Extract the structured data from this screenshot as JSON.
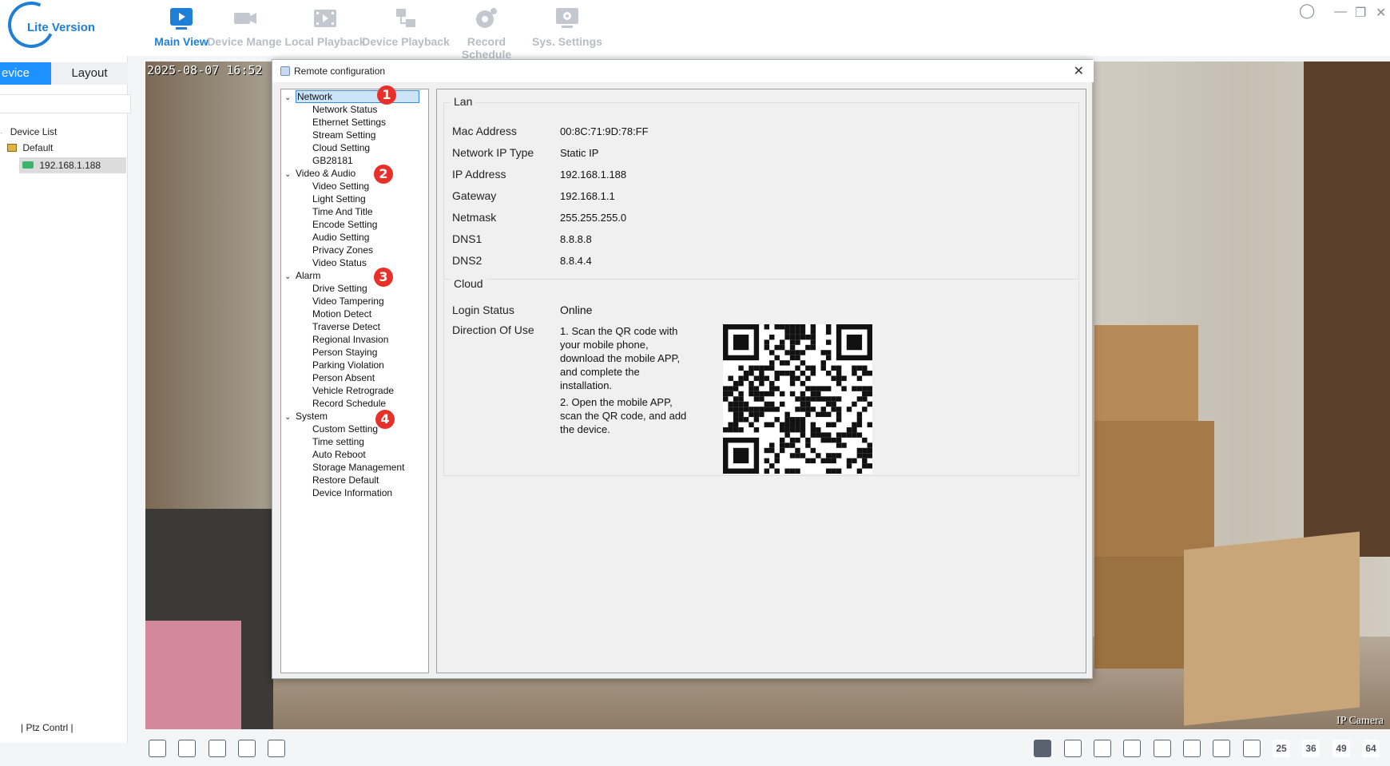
{
  "app": {
    "logo_text": "Lite Version",
    "brand_color": "#1e7fd6",
    "nav": [
      {
        "label": "Main View",
        "icon": "monitor-play-icon",
        "active": true
      },
      {
        "label": "Device Mange",
        "icon": "camera-icon",
        "active": false
      },
      {
        "label": "Local Playback",
        "icon": "film-icon",
        "active": false
      },
      {
        "label": "Device Playback",
        "icon": "network-playback-icon",
        "active": false
      },
      {
        "label": "Record Schedule",
        "icon": "record-schedule-icon",
        "active": false
      },
      {
        "label": "Sys. Settings",
        "icon": "settings-monitor-icon",
        "active": false
      }
    ],
    "window_controls": [
      "user-icon",
      "minimize-icon",
      "restore-icon",
      "close-icon"
    ]
  },
  "left_panel": {
    "tabs": [
      "evice",
      "Layout"
    ],
    "tree": {
      "root": "Device List",
      "group": "Default",
      "device": "192.168.1.188"
    },
    "ptz_label": "| Ptz Contrl |"
  },
  "video": {
    "osd_time": "2025-08-07 16:52",
    "osd_camera": "IP Camera"
  },
  "bottom_bar": {
    "left_tools": [
      "screenshot-icon",
      "fullscreen-exit-icon",
      "stop-icon",
      "loop-icon",
      "save-icon"
    ],
    "grid_labels": [
      "25",
      "36",
      "49",
      "64"
    ]
  },
  "dialog": {
    "title": "Remote configuration",
    "close_label": "✕",
    "tree": [
      {
        "label": "Network",
        "badge": "1",
        "items": [
          "Network Status",
          "Ethernet Settings",
          "Stream Setting",
          "Cloud Setting",
          "GB28181"
        ]
      },
      {
        "label": "Video & Audio",
        "badge": "2",
        "items": [
          "Video Setting",
          "Light Setting",
          "Time And Title",
          "Encode Setting",
          "Audio Setting",
          "Privacy Zones",
          "Video Status"
        ]
      },
      {
        "label": "Alarm",
        "badge": "3",
        "items": [
          "Drive Setting",
          "Video Tampering",
          "Motion Detect",
          "Traverse Detect",
          "Regional Invasion",
          "Person Staying",
          "Parking Violation",
          "Person Absent",
          "Vehicle Retrograde",
          "Record Schedule"
        ]
      },
      {
        "label": "System",
        "badge": "4",
        "items": [
          "Custom Setting",
          "Time setting",
          "Auto Reboot",
          "Storage Management",
          "Restore Default",
          "Device Information"
        ]
      }
    ],
    "lan": {
      "title": "Lan",
      "rows": [
        {
          "label": "Mac Address",
          "value": "00:8C:71:9D:78:FF"
        },
        {
          "label": "Network IP Type",
          "value": "Static IP"
        },
        {
          "label": "IP Address",
          "value": "192.168.1.188"
        },
        {
          "label": "Gateway",
          "value": "192.168.1.1"
        },
        {
          "label": "Netmask",
          "value": "255.255.255.0"
        },
        {
          "label": "DNS1",
          "value": "8.8.8.8"
        },
        {
          "label": "DNS2",
          "value": "8.8.4.4"
        }
      ]
    },
    "cloud": {
      "title": "Cloud",
      "login_label": "Login Status",
      "login_value": "Online",
      "direction_label": "Direction Of Use",
      "direction_1": "1. Scan the QR code with your mobile phone, download the mobile APP, and complete the installation.",
      "direction_2": "2. Open the mobile APP, scan the QR code, and add the device."
    }
  }
}
